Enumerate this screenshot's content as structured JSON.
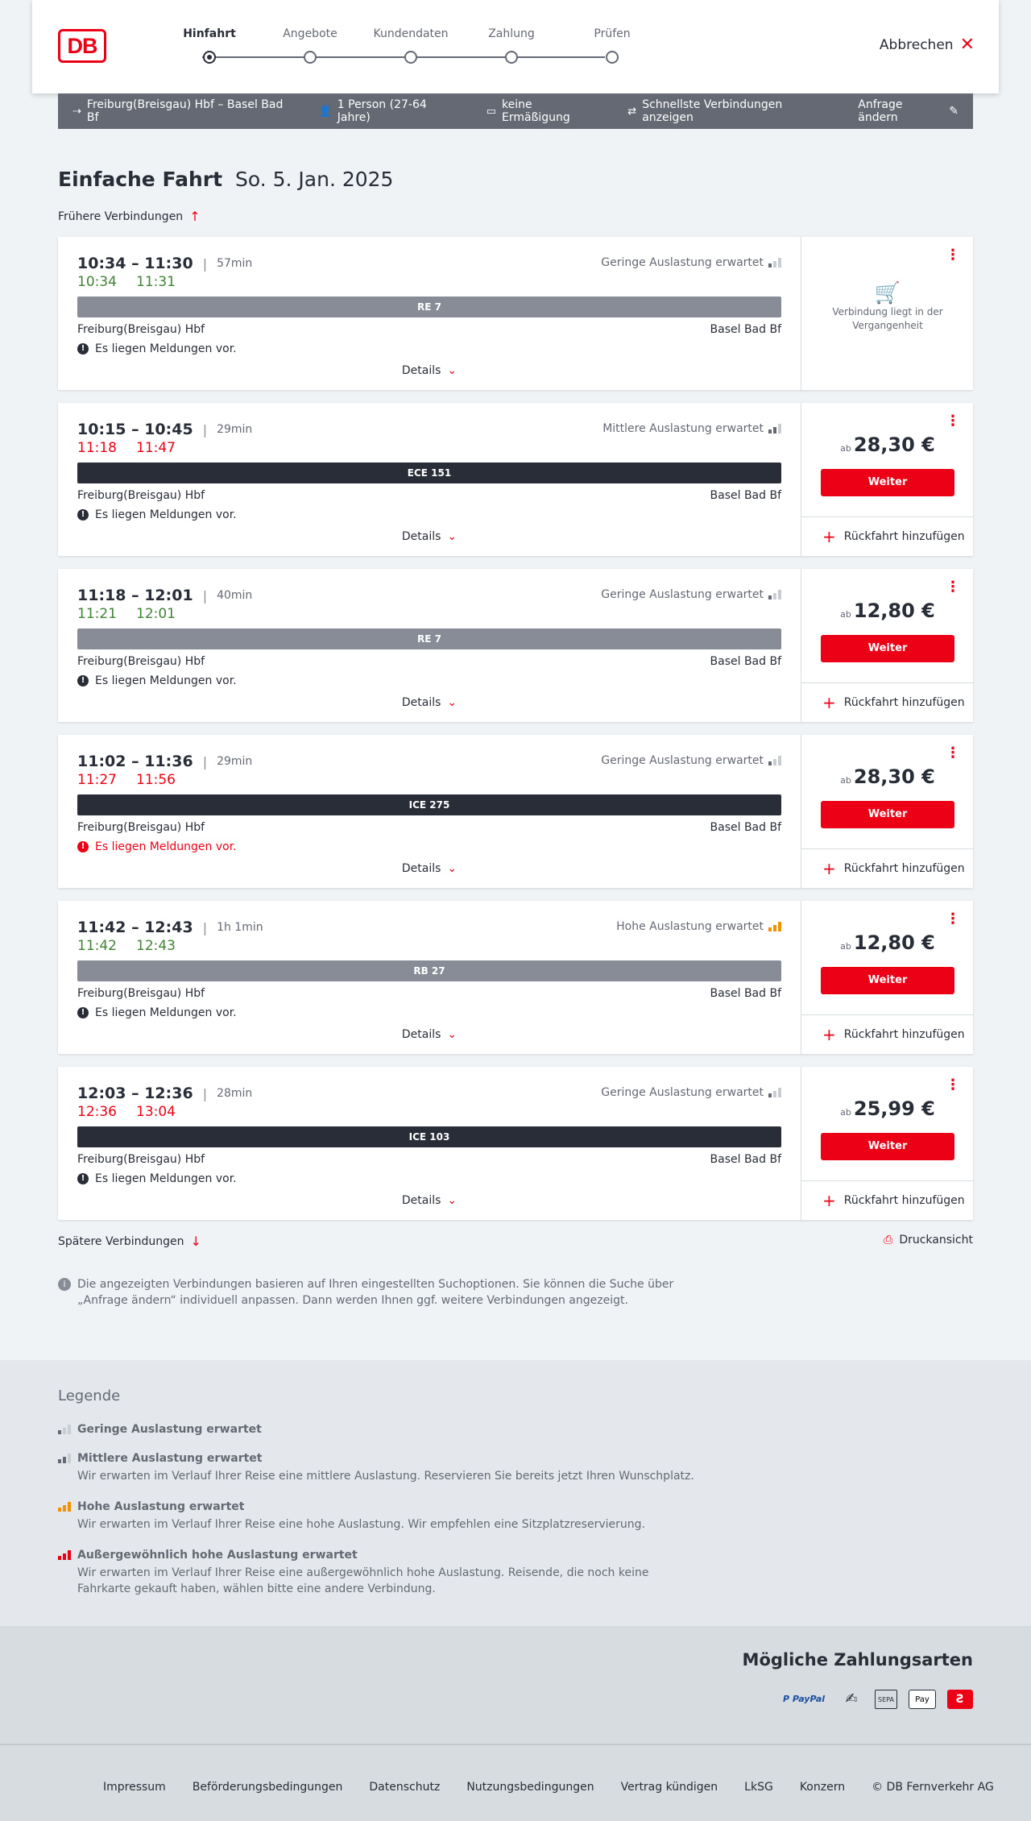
{
  "header": {
    "logo": "DB",
    "steps": [
      {
        "label": "Hinfahrt"
      },
      {
        "label": "Angebote"
      },
      {
        "label": "Kundendaten"
      },
      {
        "label": "Zahlung"
      },
      {
        "label": "Prüfen"
      }
    ],
    "cancel_label": "Abbrechen"
  },
  "searchbar": {
    "route": "Freiburg(Breisgau) Hbf – Basel Bad Bf",
    "passengers": "1 Person (27-64 Jahre)",
    "discount": "keine Ermäßigung",
    "fastest": "Schnellste Verbindungen anzeigen",
    "change": "Anfrage ändern"
  },
  "title": {
    "type": "Einfache Fahrt",
    "date": "So. 5. Jan. 2025"
  },
  "earlier_label": "Frühere Verbindungen",
  "later_label": "Spätere Verbindungen",
  "print_label": "Druckansicht",
  "connections": [
    {
      "times": "10:34 – 11:30",
      "duration": "57min",
      "rt_dep": "10:34",
      "rt_arr": "11:31",
      "rt_status": "green",
      "load": "Geringe Auslastung erwartet",
      "load_level": 1,
      "train": "RE 7",
      "train_style": "regional",
      "from": "Freiburg(Breisgau) Hbf",
      "to": "Basel Bad Bf",
      "message": "Es liegen Meldungen vor.",
      "message_severe": false,
      "details": "Details",
      "past": true,
      "past_text": "Verbindung liegt in der Vergangenheit"
    },
    {
      "times": "10:15 – 10:45",
      "duration": "29min",
      "rt_dep": "11:18",
      "rt_arr": "11:47",
      "rt_status": "red",
      "load": "Mittlere Auslastung erwartet",
      "load_level": 2,
      "train": "ECE 151",
      "train_style": "long",
      "from": "Freiburg(Breisgau) Hbf",
      "to": "Basel Bad Bf",
      "message": "Es liegen Meldungen vor.",
      "message_severe": false,
      "details": "Details",
      "past": false,
      "price_prefix": "ab",
      "price": "28,30 €",
      "button": "Weiter",
      "return": "Rückfahrt hinzufügen"
    },
    {
      "times": "11:18 – 12:01",
      "duration": "40min",
      "rt_dep": "11:21",
      "rt_arr": "12:01",
      "rt_status": "green",
      "load": "Geringe Auslastung erwartet",
      "load_level": 1,
      "train": "RE 7",
      "train_style": "regional",
      "from": "Freiburg(Breisgau) Hbf",
      "to": "Basel Bad Bf",
      "message": "Es liegen Meldungen vor.",
      "message_severe": false,
      "details": "Details",
      "past": false,
      "price_prefix": "ab",
      "price": "12,80 €",
      "button": "Weiter",
      "return": "Rückfahrt hinzufügen"
    },
    {
      "times": "11:02 – 11:36",
      "duration": "29min",
      "rt_dep": "11:27",
      "rt_arr": "11:56",
      "rt_status": "red",
      "load": "Geringe Auslastung erwartet",
      "load_level": 1,
      "train": "ICE 275",
      "train_style": "long",
      "from": "Freiburg(Breisgau) Hbf",
      "to": "Basel Bad Bf",
      "message": "Es liegen Meldungen vor.",
      "message_severe": true,
      "details": "Details",
      "past": false,
      "price_prefix": "ab",
      "price": "28,30 €",
      "button": "Weiter",
      "return": "Rückfahrt hinzufügen"
    },
    {
      "times": "11:42 – 12:43",
      "duration": "1h 1min",
      "rt_dep": "11:42",
      "rt_arr": "12:43",
      "rt_status": "green",
      "load": "Hohe Auslastung erwartet",
      "load_level": 3,
      "train": "RB 27",
      "train_style": "regional",
      "from": "Freiburg(Breisgau) Hbf",
      "to": "Basel Bad Bf",
      "message": "Es liegen Meldungen vor.",
      "message_severe": false,
      "details": "Details",
      "past": false,
      "price_prefix": "ab",
      "price": "12,80 €",
      "button": "Weiter",
      "return": "Rückfahrt hinzufügen"
    },
    {
      "times": "12:03 – 12:36",
      "duration": "28min",
      "rt_dep": "12:36",
      "rt_arr": "13:04",
      "rt_status": "red",
      "load": "Geringe Auslastung erwartet",
      "load_level": 1,
      "train": "ICE 103",
      "train_style": "long",
      "from": "Freiburg(Breisgau) Hbf",
      "to": "Basel Bad Bf",
      "message": "Es liegen Meldungen vor.",
      "message_severe": false,
      "details": "Details",
      "past": false,
      "price_prefix": "ab",
      "price": "25,99 €",
      "button": "Weiter",
      "return": "Rückfahrt hinzufügen"
    }
  ],
  "note": "Die angezeigten Verbindungen basieren auf Ihren eingestellten Suchoptionen. Sie können die Suche über „Anfrage ändern“ individuell anpassen. Dann werden Ihnen ggf. weitere Verbindungen angezeigt.",
  "legend": {
    "title": "Legende",
    "items": [
      {
        "title": "Geringe Auslastung erwartet",
        "desc": ""
      },
      {
        "title": "Mittlere Auslastung erwartet",
        "desc": "Wir erwarten im Verlauf Ihrer Reise eine mittlere Auslastung. Reservieren Sie bereits jetzt Ihren Wunschplatz."
      },
      {
        "title": "Hohe Auslastung erwartet",
        "desc": "Wir erwarten im Verlauf Ihrer Reise eine hohe Auslastung. Wir empfehlen eine Sitzplatzreservierung."
      },
      {
        "title": "Außergewöhnlich hohe Auslastung erwartet",
        "desc": "Wir erwarten im Verlauf Ihrer Reise eine außergewöhnlich hohe Auslastung. Reisende, die noch keine Fahrkarte gekauft haben, wählen bitte eine andere Verbindung."
      }
    ]
  },
  "payment": {
    "title": "Mögliche Zahlungsarten",
    "methods": [
      "paypal-icon",
      "hand-icon",
      "sepa-icon",
      "apple-pay-icon",
      "db-icon"
    ],
    "paypal_label": "P PayPal",
    "apple_label": "Pay",
    "sepa_label": "SEPA"
  },
  "footer": {
    "links": [
      "Impressum",
      "Beförderungsbedingungen",
      "Datenschutz",
      "Nutzungsbedingungen",
      "Vertrag kündigen",
      "LkSG",
      "Konzern",
      "© DB Fernverkehr AG"
    ]
  },
  "colors": {
    "brand_red": "#ec0016",
    "on_time_green": "#408335",
    "regional_train": "#878c96",
    "long_distance_train": "#282d37",
    "high_load_orange": "#f39200"
  }
}
